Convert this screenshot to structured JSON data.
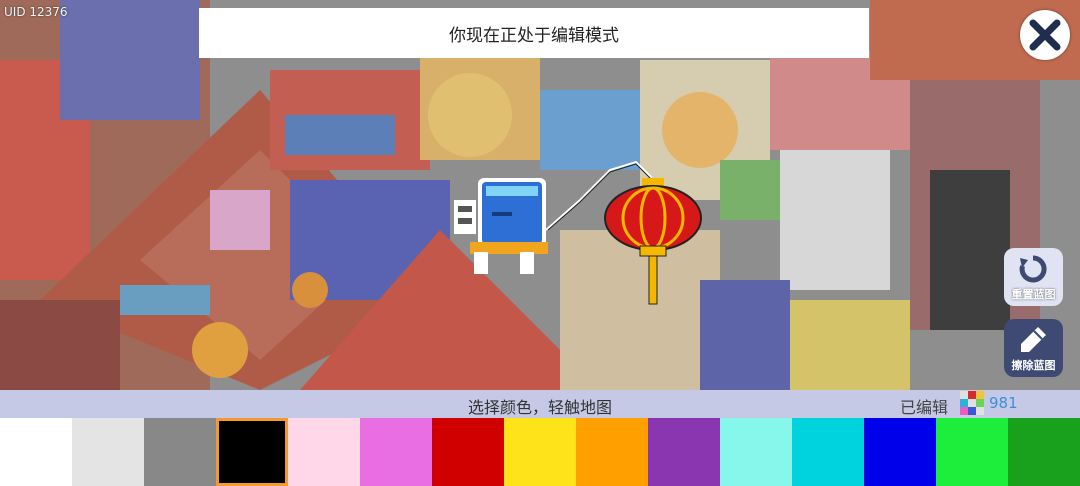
{
  "uid_label": "UID 12376",
  "mode_banner": "你现在正处于编辑模式",
  "close_button": {
    "icon": "close-icon"
  },
  "reset_button": {
    "label": "重置蓝图",
    "icon": "rotate-icon"
  },
  "erase_button": {
    "label": "擦除蓝图",
    "icon": "pencil-icon"
  },
  "status": {
    "hint": "选择颜色，轻触地图",
    "edited_label": "已编辑",
    "edited_icon": "pixel-grid-icon",
    "edited_count": "981"
  },
  "palette": {
    "selected_index": 3,
    "selected_border": "#f29a2e",
    "colors": [
      "#ffffff",
      "#e4e4e4",
      "#888888",
      "#000000",
      "#ffd7e8",
      "#e96ee3",
      "#d00000",
      "#ffe31a",
      "#ffa000",
      "#8a36b0",
      "#87f7ec",
      "#00d3dd",
      "#0000ea",
      "#1ded3b",
      "#19a01c"
    ]
  },
  "canvas": {
    "sprites": [
      "robot-character",
      "red-lantern"
    ],
    "background_colors": [
      "#a94b3d",
      "#5b63b8",
      "#d7b66a",
      "#6aa6c8",
      "#9a9a9a",
      "#c94a4a",
      "#e2c46c",
      "#7f4a7e",
      "#3d3d3d",
      "#d68c8c"
    ]
  }
}
